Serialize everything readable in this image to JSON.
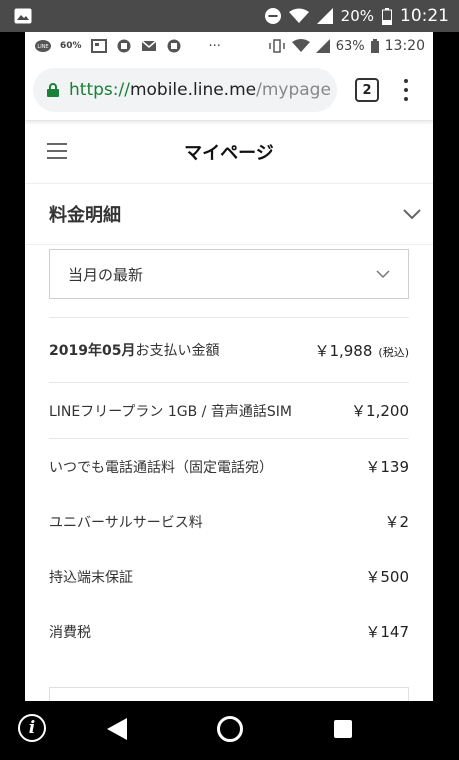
{
  "outer_status": {
    "battery": "20%",
    "time": "10:21"
  },
  "inner_status": {
    "icon_badge": "60%",
    "dots": "···",
    "battery": "63%",
    "time": "13:20"
  },
  "browser": {
    "url_scheme": "https://",
    "url_host": "mobile.line.me",
    "url_path": "/mypage",
    "tab_count": "2"
  },
  "page": {
    "title": "マイページ",
    "section_title": "料金明細",
    "period_select": "当月の最新"
  },
  "billing": {
    "total_label_bold": "2019年05月",
    "total_label": "お支払い金額",
    "total_value": "￥1,988",
    "total_tax": "(税込)",
    "items": [
      {
        "label": "LINEフリープラン 1GB / 音声通話SIM",
        "value": "￥1,200"
      },
      {
        "label": "いつでも電話通話料（固定電話宛）",
        "value": "￥139"
      },
      {
        "label": "ユニバーサルサービス料",
        "value": "￥2"
      },
      {
        "label": "持込端末保証",
        "value": "￥500"
      },
      {
        "label": "消費税",
        "value": "￥147"
      }
    ]
  },
  "colors": {
    "lock_green": "#188038",
    "status_bar": "#4a4a4a"
  }
}
